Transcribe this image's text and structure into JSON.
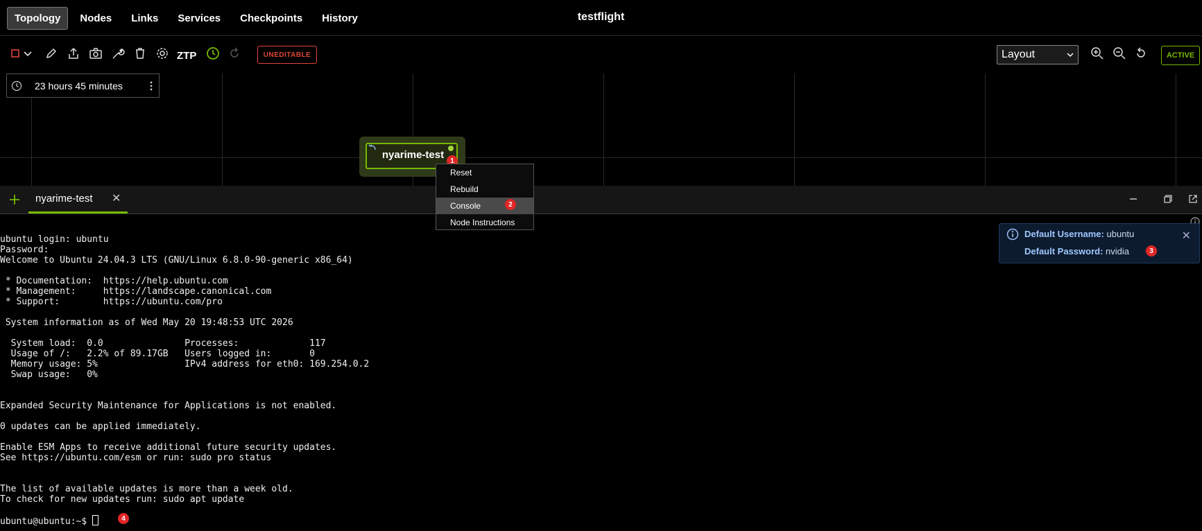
{
  "nav": {
    "tabs": [
      {
        "label": "Topology"
      },
      {
        "label": "Nodes"
      },
      {
        "label": "Links"
      },
      {
        "label": "Services"
      },
      {
        "label": "Checkpoints"
      },
      {
        "label": "History"
      }
    ],
    "title": "testflight"
  },
  "toolbar": {
    "ztp_label": "ZTP",
    "uneditable_label": "UNEDITABLE",
    "layout_label": "Layout",
    "status_label": "ACTIVE"
  },
  "timer": {
    "text": "23 hours 45 minutes"
  },
  "node": {
    "label": "nyarime-test"
  },
  "context_menu": {
    "items": [
      {
        "label": "Reset"
      },
      {
        "label": "Rebuild"
      },
      {
        "label": "Console"
      },
      {
        "label": "Node Instructions"
      }
    ]
  },
  "badges": [
    "1",
    "2",
    "3",
    "4"
  ],
  "console_tab": {
    "label": "nyarime-test",
    "close": "✕"
  },
  "toast": {
    "username_key": "Default Username:",
    "username_val": "ubuntu",
    "password_key": "Default Password:",
    "password_val": "nvidia"
  },
  "terminal": {
    "lines": [
      "ubuntu login: ubuntu",
      "Password:",
      "Welcome to Ubuntu 24.04.3 LTS (GNU/Linux 6.8.0-90-generic x86_64)",
      "",
      " * Documentation:  https://help.ubuntu.com",
      " * Management:     https://landscape.canonical.com",
      " * Support:        https://ubuntu.com/pro",
      "",
      " System information as of Wed May 20 19:48:53 UTC 2026",
      "",
      "  System load:  0.0               Processes:             117",
      "  Usage of /:   2.2% of 89.17GB   Users logged in:       0",
      "  Memory usage: 5%                IPv4 address for eth0: 169.254.0.2",
      "  Swap usage:   0%",
      "",
      "",
      "Expanded Security Maintenance for Applications is not enabled.",
      "",
      "0 updates can be applied immediately.",
      "",
      "Enable ESM Apps to receive additional future security updates.",
      "See https://ubuntu.com/esm or run: sudo pro status",
      "",
      "",
      "The list of available updates is more than a week old.",
      "To check for new updates run: sudo apt update",
      ""
    ],
    "prompt": "ubuntu@ubuntu:~$ "
  },
  "colors": {
    "accent": "#76b900",
    "danger": "#e0453a",
    "badge": "#e02626"
  }
}
